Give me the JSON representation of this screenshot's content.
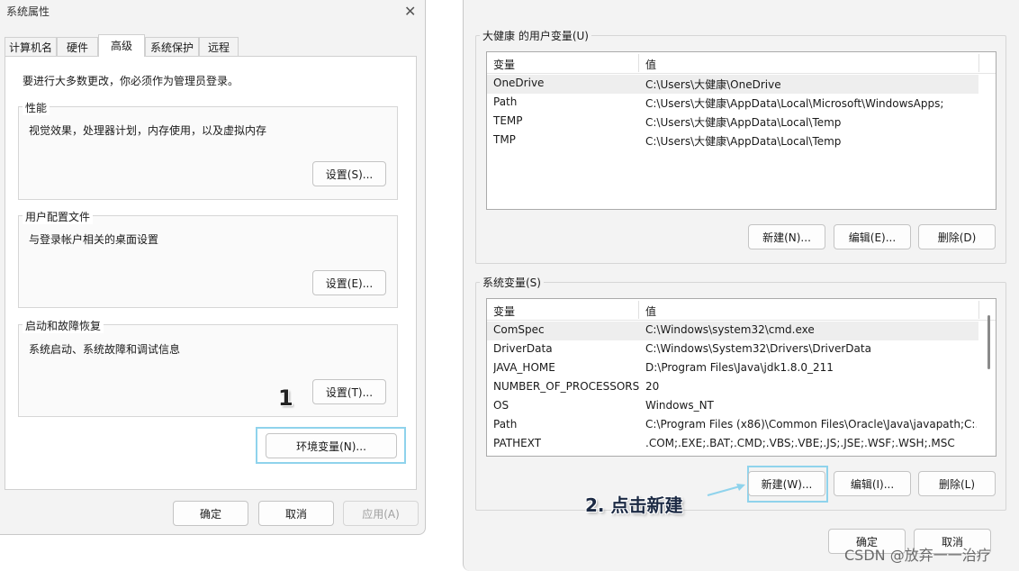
{
  "left_dialog": {
    "title": "系统属性",
    "close_glyph": "✕",
    "tabs": [
      {
        "label": "计算机名"
      },
      {
        "label": "硬件"
      },
      {
        "label": "高级"
      },
      {
        "label": "系统保护"
      },
      {
        "label": "远程"
      }
    ],
    "admin_note": "要进行大多数更改，你必须作为管理员登录。",
    "groups": {
      "performance": {
        "title": "性能",
        "desc": "视觉效果，处理器计划，内存使用，以及虚拟内存",
        "button": "设置(S)..."
      },
      "profile": {
        "title": "用户配置文件",
        "desc": "与登录帐户相关的桌面设置",
        "button": "设置(E)..."
      },
      "startup": {
        "title": "启动和故障恢复",
        "desc": "系统启动、系统故障和调试信息",
        "button": "设置(T)..."
      }
    },
    "env_button": "环境变量(N)...",
    "ok": "确定",
    "cancel": "取消",
    "apply": "应用(A)"
  },
  "annotation_step1": "1",
  "right_dialog": {
    "user_section_title": "大健康 的用户变量(U)",
    "columns": {
      "name": "变量",
      "value": "值"
    },
    "user_vars": [
      {
        "name": "OneDrive",
        "value": "C:\\Users\\大健康\\OneDrive"
      },
      {
        "name": "Path",
        "value": "C:\\Users\\大健康\\AppData\\Local\\Microsoft\\WindowsApps;"
      },
      {
        "name": "TEMP",
        "value": "C:\\Users\\大健康\\AppData\\Local\\Temp"
      },
      {
        "name": "TMP",
        "value": "C:\\Users\\大健康\\AppData\\Local\\Temp"
      }
    ],
    "user_buttons": {
      "new": "新建(N)...",
      "edit": "编辑(E)...",
      "delete": "删除(D)"
    },
    "system_section_title": "系统变量(S)",
    "system_vars": [
      {
        "name": "ComSpec",
        "value": "C:\\Windows\\system32\\cmd.exe"
      },
      {
        "name": "DriverData",
        "value": "C:\\Windows\\System32\\Drivers\\DriverData"
      },
      {
        "name": "JAVA_HOME",
        "value": "D:\\Program Files\\Java\\jdk1.8.0_211"
      },
      {
        "name": "NUMBER_OF_PROCESSORS",
        "value": "20"
      },
      {
        "name": "OS",
        "value": "Windows_NT"
      },
      {
        "name": "Path",
        "value": "C:\\Program Files (x86)\\Common Files\\Oracle\\Java\\javapath;C:..."
      },
      {
        "name": "PATHEXT",
        "value": ".COM;.EXE;.BAT;.CMD;.VBS;.VBE;.JS;.JSE;.WSF;.WSH;.MSC"
      }
    ],
    "system_buttons": {
      "new": "新建(W)...",
      "edit": "编辑(I)...",
      "delete": "删除(L)"
    },
    "ok": "确定",
    "cancel": "取消"
  },
  "annotation_step2": "2. 点击新建",
  "watermark": "CSDN @放弃一一治疗",
  "colors": {
    "highlight": "#8fd3ec",
    "selected_row": "#eeeeee",
    "arrow": "#8fd3ec"
  }
}
